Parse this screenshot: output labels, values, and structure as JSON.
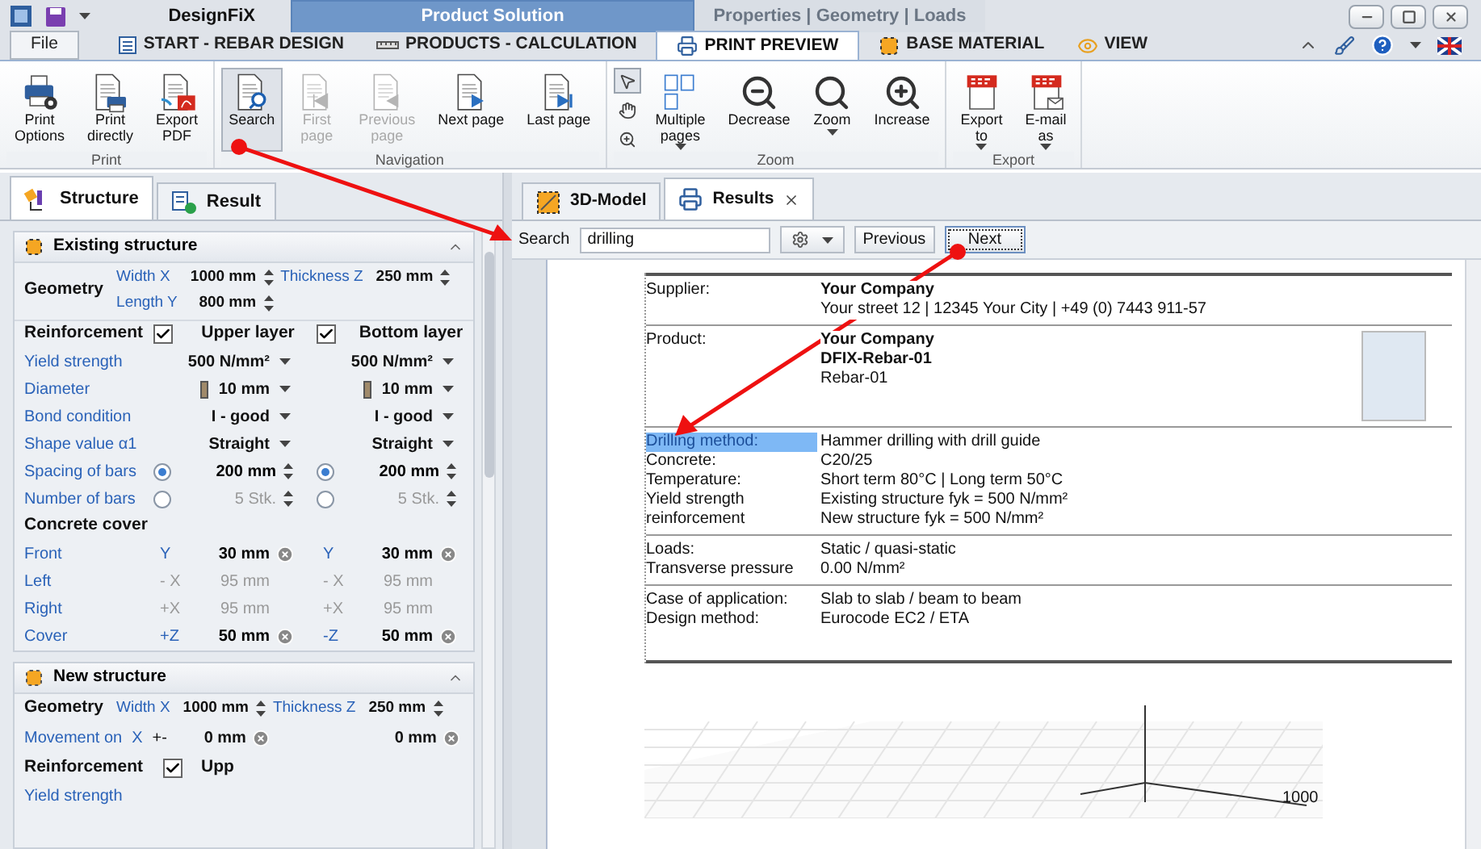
{
  "title_bar": {
    "title": "DesignFiX",
    "context_groups": [
      {
        "label": "Product Solution",
        "selected": true
      },
      {
        "label": "Properties | Geometry | Loads",
        "selected": false
      }
    ]
  },
  "ribbon_tabs": [
    {
      "label": "File",
      "selected": false
    },
    {
      "label": "START - REBAR DESIGN",
      "selected": false
    },
    {
      "label": "PRODUCTS - CALCULATION",
      "selected": false
    },
    {
      "label": "PRINT PREVIEW",
      "selected": true
    },
    {
      "label": "BASE MATERIAL",
      "selected": false
    },
    {
      "label": "VIEW",
      "selected": false
    }
  ],
  "ribbon_groups": [
    {
      "label": "Print",
      "buttons": [
        {
          "lines": [
            "Print",
            "Options"
          ],
          "disabled": false,
          "pressed": false,
          "dropdown": false
        },
        {
          "lines": [
            "Print",
            "directly"
          ],
          "disabled": false,
          "pressed": false,
          "dropdown": false
        },
        {
          "lines": [
            "Export",
            "PDF"
          ],
          "disabled": false,
          "pressed": false,
          "dropdown": false
        }
      ]
    },
    {
      "label": "Navigation",
      "buttons": [
        {
          "lines": [
            "Search"
          ],
          "disabled": false,
          "pressed": true,
          "dropdown": false
        },
        {
          "lines": [
            "First",
            "page"
          ],
          "disabled": true,
          "pressed": false,
          "dropdown": false
        },
        {
          "lines": [
            "Previous",
            "page"
          ],
          "disabled": true,
          "pressed": false,
          "dropdown": false
        },
        {
          "lines": [
            "Next page"
          ],
          "disabled": false,
          "pressed": false,
          "dropdown": false
        },
        {
          "lines": [
            "Last page"
          ],
          "disabled": false,
          "pressed": false,
          "dropdown": false
        }
      ]
    },
    {
      "label": "Zoom",
      "tools": [
        {
          "selected": true
        },
        {
          "selected": false
        },
        {
          "selected": false
        }
      ],
      "buttons": [
        {
          "lines": [
            "Multiple",
            "pages"
          ],
          "disabled": false,
          "pressed": false,
          "dropdown": true
        },
        {
          "lines": [
            "Decrease"
          ],
          "disabled": false,
          "pressed": false,
          "dropdown": false
        },
        {
          "lines": [
            "Zoom"
          ],
          "disabled": false,
          "pressed": false,
          "dropdown": true
        },
        {
          "lines": [
            "Increase"
          ],
          "disabled": false,
          "pressed": false,
          "dropdown": false
        }
      ]
    },
    {
      "label": "Export",
      "buttons": [
        {
          "lines": [
            "Export",
            "to"
          ],
          "disabled": false,
          "pressed": false,
          "dropdown": true
        },
        {
          "lines": [
            "E-mail",
            "as"
          ],
          "disabled": false,
          "pressed": false,
          "dropdown": true
        }
      ]
    }
  ],
  "left_tabs": [
    {
      "label": "Structure",
      "selected": true
    },
    {
      "label": "Result",
      "selected": false
    }
  ],
  "existing_structure": {
    "title": "Existing structure",
    "expanded": true,
    "geometry": {
      "label": "Geometry",
      "fields": [
        {
          "label": "Width X",
          "value": "1000 mm"
        },
        {
          "label": "Thickness Z",
          "value": "250 mm"
        },
        {
          "label": "Length Y",
          "value": "800 mm"
        }
      ]
    },
    "reinforcement": {
      "label": "Reinforcement",
      "layers": [
        {
          "label": "Upper layer",
          "checked": true
        },
        {
          "label": "Bottom layer",
          "checked": true
        }
      ],
      "rows": [
        {
          "kind": "dropdown",
          "label": "Yield strength",
          "cells": [
            {
              "value": "500 N/mm²"
            },
            {
              "value": "500 N/mm²"
            }
          ]
        },
        {
          "kind": "diameter",
          "label": "Diameter",
          "cells": [
            {
              "value": "10 mm"
            },
            {
              "value": "10 mm"
            }
          ]
        },
        {
          "kind": "dropdown",
          "label": "Bond condition",
          "cells": [
            {
              "value": "I - good"
            },
            {
              "value": "I - good"
            }
          ]
        },
        {
          "kind": "dropdown",
          "label": "Shape value α1",
          "cells": [
            {
              "value": "Straight"
            },
            {
              "value": "Straight"
            }
          ]
        },
        {
          "kind": "radio",
          "label": "Spacing of bars",
          "cells": [
            {
              "value": "200 mm",
              "selected": true
            },
            {
              "value": "200 mm",
              "selected": true
            }
          ]
        },
        {
          "kind": "radio",
          "label": "Number of bars",
          "cells": [
            {
              "value": "5 Stk.",
              "selected": false
            },
            {
              "value": "5 Stk.",
              "selected": false
            }
          ]
        },
        {
          "kind": "heading",
          "label": "Concrete cover",
          "cells": []
        },
        {
          "kind": "cover",
          "label": "Front",
          "cells": [
            {
              "axis": "Y",
              "value": "30 mm",
              "disabled": false
            },
            {
              "axis": "Y",
              "value": "30 mm",
              "disabled": false
            }
          ]
        },
        {
          "kind": "cover",
          "label": "Left",
          "cells": [
            {
              "axis": "- X",
              "value": "95 mm",
              "disabled": true
            },
            {
              "axis": "- X",
              "value": "95 mm",
              "disabled": true
            }
          ]
        },
        {
          "kind": "cover",
          "label": "Right",
          "cells": [
            {
              "axis": "+X",
              "value": "95 mm",
              "disabled": true
            },
            {
              "axis": "+X",
              "value": "95 mm",
              "disabled": true
            }
          ]
        },
        {
          "kind": "cover",
          "label": "Cover",
          "cells": [
            {
              "axis": "+Z",
              "value": "50 mm",
              "disabled": false
            },
            {
              "axis": "-Z",
              "value": "50 mm",
              "disabled": false
            }
          ]
        }
      ]
    }
  },
  "new_structure": {
    "title": "New structure",
    "expanded": true,
    "geometry": {
      "label": "Geometry",
      "fields": [
        {
          "label": "Width X",
          "value": "1000 mm"
        },
        {
          "label": "Thickness Z",
          "value": "250 mm"
        }
      ]
    },
    "movement": {
      "label": "Movement on",
      "axis": "X",
      "sign": "+-",
      "values": [
        "0 mm",
        "0 mm"
      ]
    },
    "reinforcement": {
      "label": "Reinforcement",
      "checked": true,
      "layer": "Upp"
    },
    "next_row": "Yield strength"
  },
  "right_tabs": [
    {
      "label": "3D-Model",
      "selected": false,
      "closable": false
    },
    {
      "label": "Results",
      "selected": true,
      "closable": true
    }
  ],
  "search_bar": {
    "label": "Search",
    "value": "drilling",
    "buttons": [
      {
        "label": "Previous",
        "focused": false
      },
      {
        "label": "Next",
        "focused": true
      }
    ]
  },
  "report": {
    "sections": [
      {
        "rows": [
          {
            "label": [
              "Supplier:"
            ],
            "highlighted": false,
            "values": [
              {
                "text": "Your Company",
                "bold": true
              },
              {
                "text": "Your street 12 | 12345 Your City | +49 (0) 7443 911-57"
              }
            ]
          }
        ]
      },
      {
        "logo": true,
        "rows": [
          {
            "label": [
              "Product:"
            ],
            "highlighted": false,
            "values": [
              {
                "text": "Your Company",
                "bold": true
              },
              {
                "text": "DFIX-Rebar-01",
                "bold": true
              },
              {
                "text": "Rebar-01"
              }
            ]
          }
        ]
      },
      {
        "rows": [
          {
            "label": [
              "Drilling method:"
            ],
            "highlighted": true,
            "values": [
              {
                "text": "Hammer drilling with drill guide"
              }
            ]
          },
          {
            "label": [
              "Concrete:"
            ],
            "highlighted": false,
            "values": [
              {
                "text": "C20/25"
              }
            ]
          },
          {
            "label": [
              "Temperature:"
            ],
            "highlighted": false,
            "values": [
              {
                "text": "Short term 80°C | Long term 50°C"
              }
            ]
          },
          {
            "label": [
              "Yield strength",
              "reinforcement"
            ],
            "highlighted": false,
            "values": [
              {
                "text": "Existing structure fyk = 500 N/mm²"
              },
              {
                "text": "New structure fyk = 500 N/mm²"
              }
            ]
          }
        ]
      },
      {
        "rows": [
          {
            "label": [
              "Loads:"
            ],
            "highlighted": false,
            "values": [
              {
                "text": "Static / quasi-static"
              }
            ]
          },
          {
            "label": [
              "Transverse pressure"
            ],
            "highlighted": false,
            "values": [
              {
                "text": "0.00 N/mm²"
              }
            ]
          }
        ]
      },
      {
        "rows": [
          {
            "label": [
              "Case of application:"
            ],
            "highlighted": false,
            "values": [
              {
                "text": "Slab to slab / beam to beam"
              }
            ]
          },
          {
            "label": [
              "Design method:"
            ],
            "highlighted": false,
            "values": [
              {
                "text": "Eurocode EC2 / ETA"
              }
            ]
          }
        ]
      }
    ]
  },
  "viewport": {
    "axis_label": "1000"
  }
}
